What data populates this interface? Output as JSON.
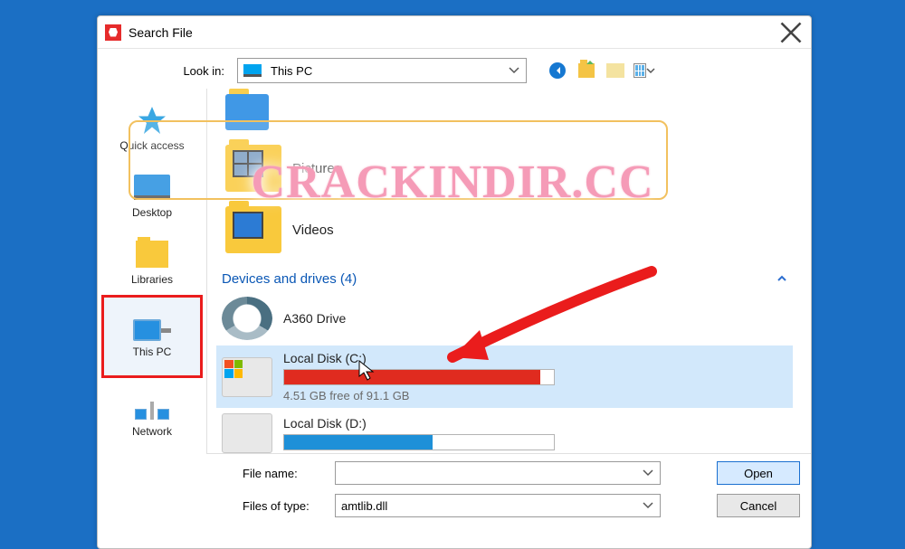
{
  "window": {
    "title": "Search File"
  },
  "toolbar": {
    "look_in_label": "Look in:",
    "look_in_value": "This PC"
  },
  "sidebar": {
    "items": [
      {
        "label": "Quick access"
      },
      {
        "label": "Desktop"
      },
      {
        "label": "Libraries"
      },
      {
        "label": "This PC"
      },
      {
        "label": "Network"
      }
    ]
  },
  "main": {
    "folder_pictures": "Pictures",
    "folder_videos": "Videos",
    "group_label": "Devices and drives (4)",
    "a360": "A360 Drive",
    "drive_c": {
      "name": "Local Disk (C:)",
      "free_text": "4.51 GB free of 91.1 GB",
      "fill_percent": 95,
      "fill_color": "#e02b1f"
    },
    "drive_d": {
      "name": "Local Disk (D:)",
      "fill_percent": 55,
      "fill_color": "#1e90d8"
    }
  },
  "footer": {
    "file_name_label": "File name:",
    "file_name_value": "",
    "file_type_label": "Files of type:",
    "file_type_value": "amtlib.dll",
    "open_label": "Open",
    "cancel_label": "Cancel"
  },
  "watermark": "CRACKINDIR.CC"
}
